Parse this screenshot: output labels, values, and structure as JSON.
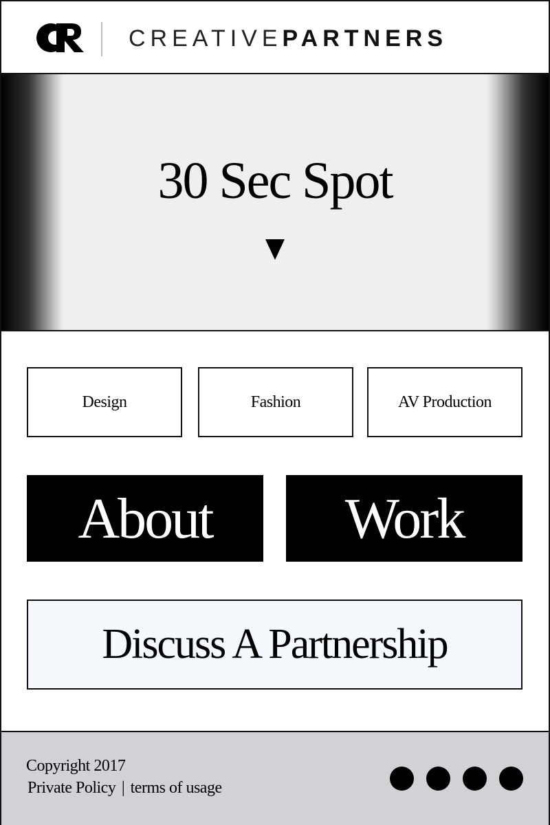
{
  "header": {
    "logo_text": "CR",
    "brand_light": "CREATIVE",
    "brand_bold": "PARTNERS"
  },
  "hero": {
    "title": "30 Sec Spot"
  },
  "categories": [
    {
      "label": "Design"
    },
    {
      "label": "Fashion"
    },
    {
      "label": "AV Production"
    }
  ],
  "actions": {
    "about_label": "About",
    "work_label": "Work",
    "partnership_label": "Discuss A Partnership"
  },
  "footer": {
    "copyright": "Copyright 2017",
    "privacy_label": "Private Policy",
    "separator": "|",
    "terms_label": "terms of usage",
    "dot_count": 4
  }
}
